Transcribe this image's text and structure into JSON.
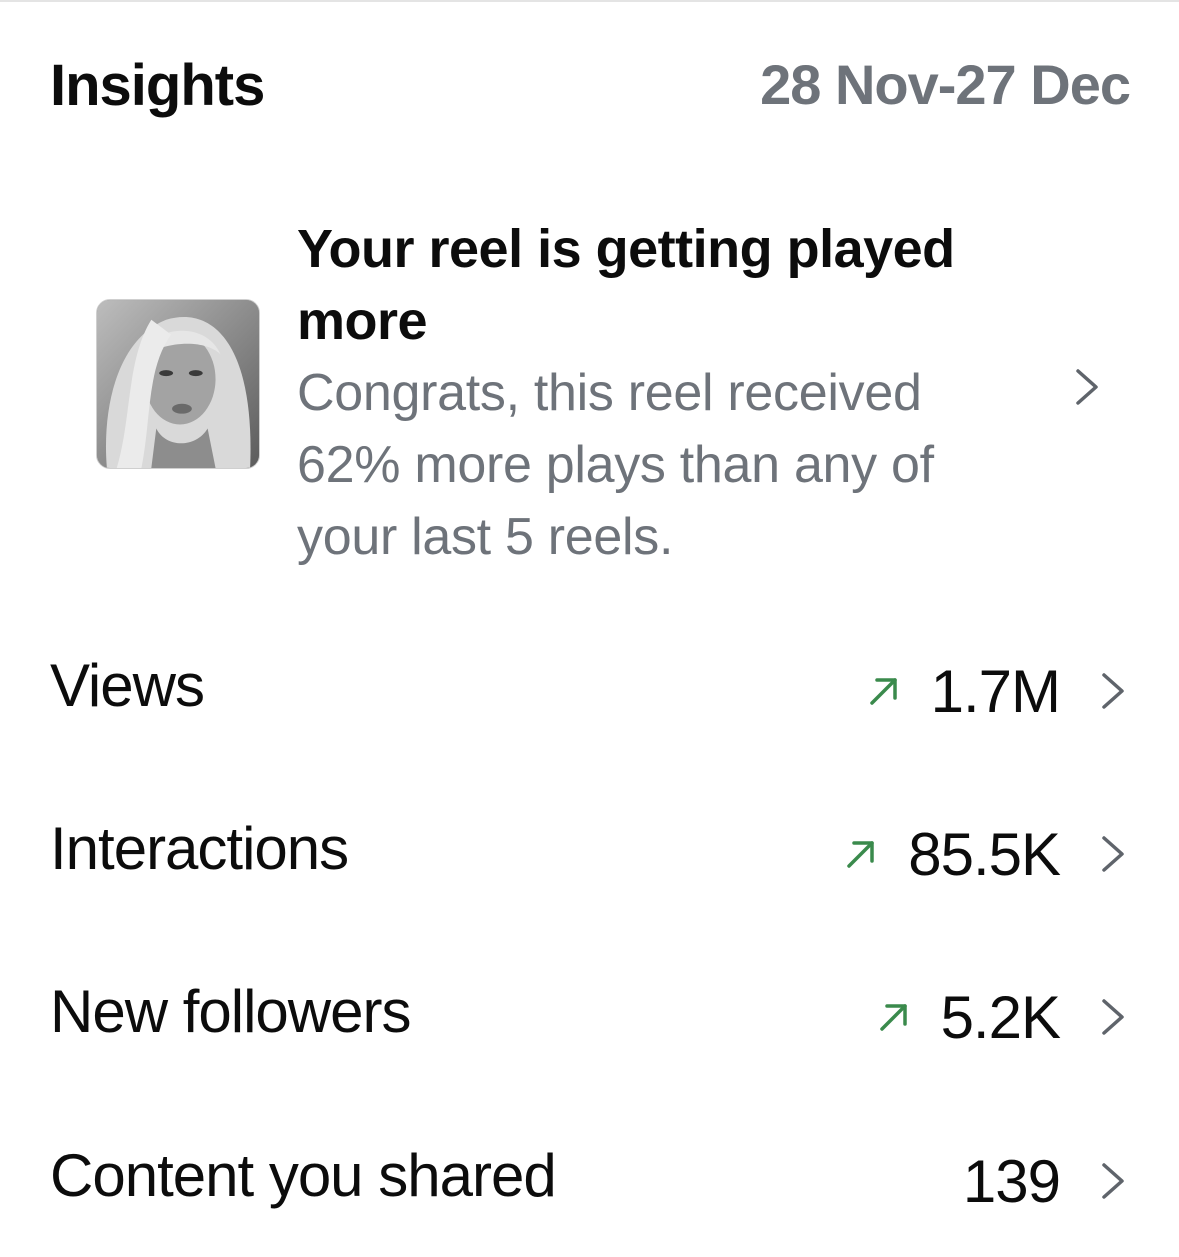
{
  "header": {
    "title": "Insights",
    "date_range": "28 Nov-27 Dec"
  },
  "highlight": {
    "title": "Your reel is getting played more",
    "body": "Congrats, this reel received 62% more plays than any of your last 5 reels.",
    "thumbnail_icon": "reel-thumbnail"
  },
  "metrics": [
    {
      "label": "Views",
      "value": "1.7M",
      "trend": "up"
    },
    {
      "label": "Interactions",
      "value": "85.5K",
      "trend": "up"
    },
    {
      "label": "New followers",
      "value": "5.2K",
      "trend": "up"
    },
    {
      "label": "Content you shared",
      "value": "139",
      "trend": "none"
    }
  ],
  "colors": {
    "text_primary": "#0c0c0c",
    "text_secondary": "#6e737a",
    "trend_up": "#3a8a4c",
    "chevron": "#5f646b"
  }
}
